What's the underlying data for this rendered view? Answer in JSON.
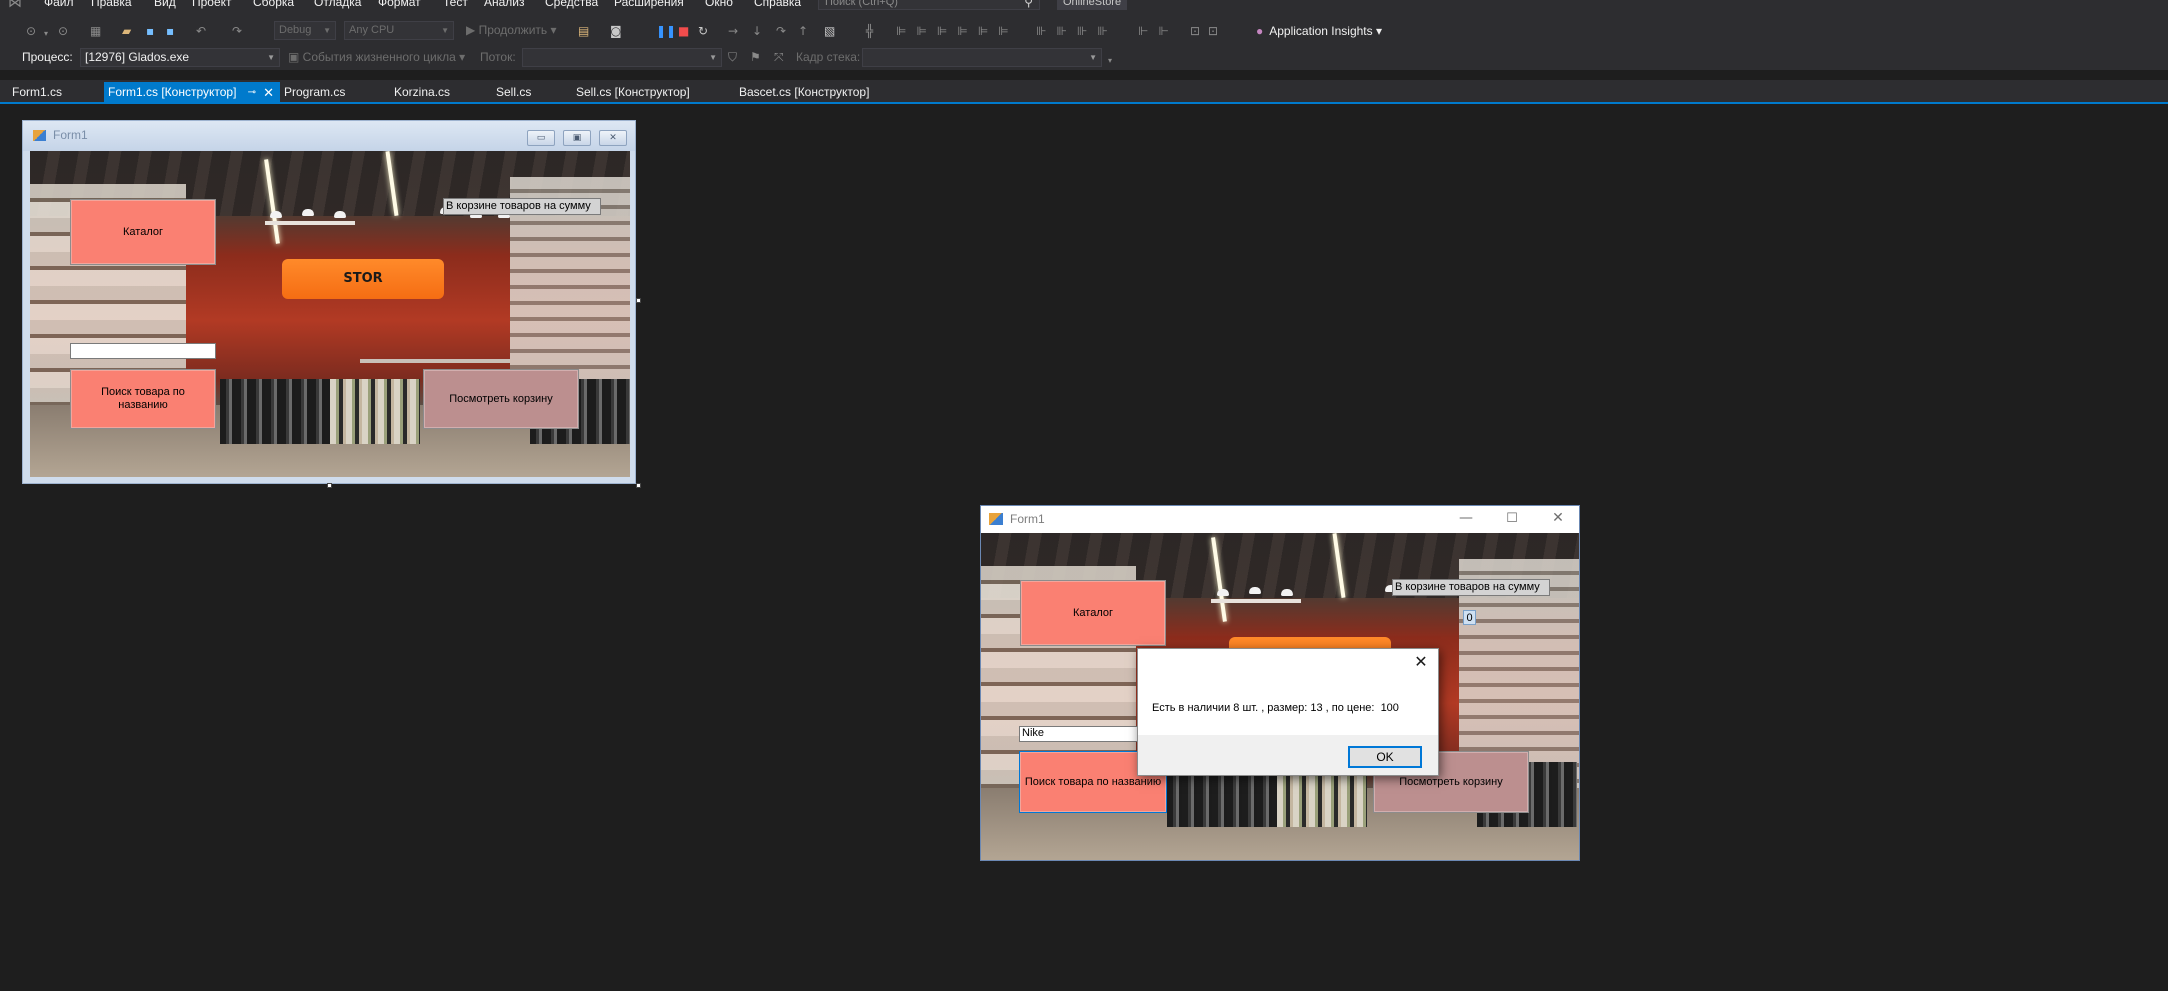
{
  "menu": {
    "items": [
      "Файл",
      "Правка",
      "Вид",
      "Проект",
      "Сборка",
      "Отладка",
      "Формат",
      "Тест",
      "Анализ",
      "Средства",
      "Расширения",
      "Окно",
      "Справка"
    ],
    "search_placeholder": "Поиск (Ctrl+Q)",
    "solution": "OnlineStore"
  },
  "toolbar": {
    "config": "Debug",
    "platform": "Any CPU",
    "continue_label": "Продолжить",
    "app_insights": "Application Insights",
    "icons": [
      "back-icon",
      "forward-icon",
      "new-project-icon",
      "open-file-icon",
      "save-icon",
      "save-all-icon",
      "undo-icon",
      "redo-icon",
      "play-icon",
      "pause-icon",
      "stop-icon",
      "restart-icon",
      "step-icons"
    ]
  },
  "debugbar": {
    "process_label": "Процесс:",
    "process_value": "[12976] Glados.exe",
    "lifecycle_label": "События жизненного цикла",
    "thread_label": "Поток:",
    "frame_label": "Кадр стека:"
  },
  "tabs": [
    {
      "label": "Form1.cs",
      "active": false
    },
    {
      "label": "Form1.cs [Конструктор]",
      "active": true
    },
    {
      "label": "Program.cs",
      "active": false
    },
    {
      "label": "Korzina.cs",
      "active": false
    },
    {
      "label": "Sell.cs",
      "active": false
    },
    {
      "label": "Sell.cs [Конструктор]",
      "active": false
    },
    {
      "label": "Bascet.cs [Конструктор]",
      "active": false
    }
  ],
  "designer_form": {
    "title": "Form1",
    "catalog_button": "Каталог",
    "cart_sum_label": "В корзине товаров на сумму",
    "search_box_value": "",
    "search_button": "Поиск товара по названию",
    "view_cart_button": "Посмотреть корзину",
    "sign_text": "STOR"
  },
  "running_form": {
    "title": "Form1",
    "catalog_button": "Каталог",
    "cart_sum_label": "В корзине товаров на сумму",
    "cart_sum_value": "0",
    "search_box_value": "Nike",
    "search_button": "Поиск товара по названию",
    "view_cart_button": "Посмотреть корзину"
  },
  "message_box": {
    "text": "Есть в наличии 8 шт. , размер: 13 , по цене:  100",
    "ok_label": "OK"
  },
  "colors": {
    "ide_background": "#1e1e1e",
    "ide_chrome": "#2d2d30",
    "accent": "#007acc",
    "salmon_button": "#fa8072",
    "rosy_button": "#bc8f8f"
  }
}
